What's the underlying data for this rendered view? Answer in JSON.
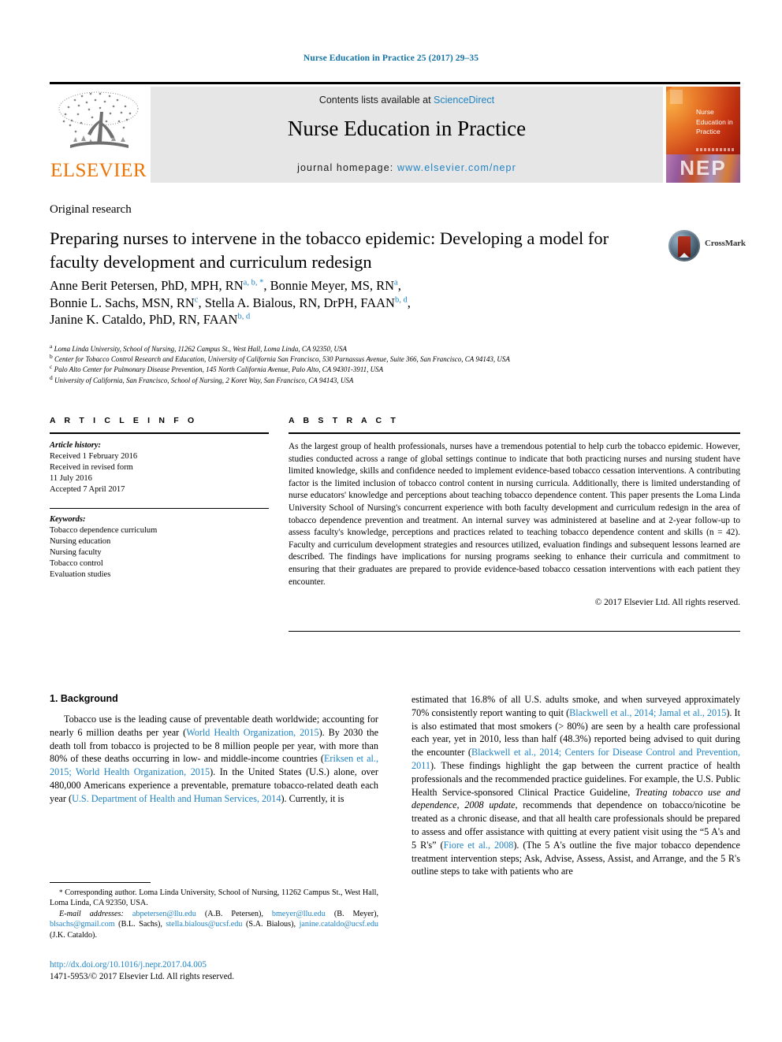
{
  "running_head": "Nurse Education in Practice 25 (2017) 29–35",
  "masthead": {
    "contents_prefix": "Contents lists available at ",
    "sciencedirect": "ScienceDirect",
    "journal_title": "Nurse Education in Practice",
    "homepage_prefix": "journal homepage: ",
    "homepage_url": "www.elsevier.com/nepr",
    "publisher_name": "ELSEVIER",
    "cover_title": "Nurse Education in Practice",
    "cover_abbrev": "NEP",
    "accent_link_color": "#1f83c4",
    "publisher_color": "#ec7404"
  },
  "article": {
    "type": "Original research",
    "title": "Preparing nurses to intervene in the tobacco epidemic: Developing a model for faculty development and curriculum redesign",
    "crossmark_label": "CrossMark"
  },
  "authors": {
    "line1": "Anne Berit Petersen, PhD, MPH, RN",
    "line1_marks": "a, b, *",
    "line1_cont": ", Bonnie Meyer, MS, RN",
    "line1_cont_marks": "a",
    "line2": "Bonnie L. Sachs, MSN, RN",
    "line2_marks": "c",
    "line2_cont": ", Stella A. Bialous, RN, DrPH, FAAN",
    "line2_cont_marks": "b, d",
    "line3": "Janine K. Cataldo, PhD, RN, FAAN",
    "line3_marks": "b, d"
  },
  "affiliations": [
    {
      "mark": "a",
      "text": "Loma Linda University, School of Nursing, 11262 Campus St., West Hall, Loma Linda, CA 92350, USA"
    },
    {
      "mark": "b",
      "text": "Center for Tobacco Control Research and Education, University of California San Francisco, 530 Parnassus Avenue, Suite 366, San Francisco, CA 94143, USA"
    },
    {
      "mark": "c",
      "text": "Palo Alto Center for Pulmonary Disease Prevention, 145 North California Avenue, Palo Alto, CA 94301-3911, USA"
    },
    {
      "mark": "d",
      "text": "University of California, San Francisco, School of Nursing, 2 Koret Way, San Francisco, CA 94143, USA"
    }
  ],
  "article_info": {
    "heading": "A R T I C L E  I N F O",
    "history_label": "Article history:",
    "history": [
      "Received 1 February 2016",
      "Received in revised form",
      "11 July 2016",
      "Accepted 7 April 2017"
    ],
    "keywords_label": "Keywords:",
    "keywords": [
      "Tobacco dependence curriculum",
      "Nursing education",
      "Nursing faculty",
      "Tobacco control",
      "Evaluation studies"
    ]
  },
  "abstract": {
    "heading": "A B S T R A C T",
    "text": "As the largest group of health professionals, nurses have a tremendous potential to help curb the tobacco epidemic. However, studies conducted across a range of global settings continue to indicate that both practicing nurses and nursing student have limited knowledge, skills and confidence needed to implement evidence-based tobacco cessation interventions. A contributing factor is the limited inclusion of tobacco control content in nursing curricula. Additionally, there is limited understanding of nurse educators' knowledge and perceptions about teaching tobacco dependence content. This paper presents the Loma Linda University School of Nursing's concurrent experience with both faculty development and curriculum redesign in the area of tobacco dependence prevention and treatment. An internal survey was administered at baseline and at 2-year follow-up to assess faculty's knowledge, perceptions and practices related to teaching tobacco dependence content and skills (n = 42). Faculty and curriculum development strategies and resources utilized, evaluation findings and subsequent lessons learned are described. The findings have implications for nursing programs seeking to enhance their curricula and commitment to ensuring that their graduates are prepared to provide evidence-based tobacco cessation interventions with each patient they encounter.",
    "copyright": "© 2017 Elsevier Ltd. All rights reserved."
  },
  "body": {
    "section_heading": "1. Background",
    "left_para_1": "Tobacco use is the leading cause of preventable death worldwide; accounting for nearly 6 million deaths per year (",
    "left_ref_1": "World Health Organization, 2015",
    "left_para_2": "). By 2030 the death toll from tobacco is projected to be 8 million people per year, with more than 80% of these deaths occurring in low- and middle-income countries (",
    "left_ref_2": "Eriksen et al., 2015; World Health Organization, 2015",
    "left_para_3": "). In the United States (U.S.) alone, over 480,000 Americans experience a preventable, premature tobacco-related death each year (",
    "left_ref_3": "U.S. Department of Health and Human Services, 2014",
    "left_para_4": "). Currently, it is",
    "right_para_1": "estimated that 16.8% of all U.S. adults smoke, and when surveyed approximately 70% consistently report wanting to quit (",
    "right_ref_1": "Blackwell et al., 2014; Jamal et al., 2015",
    "right_para_2": "). It is also estimated that most smokers (> 80%) are seen by a health care professional each year, yet in 2010, less than half (48.3%) reported being advised to quit during the encounter (",
    "right_ref_2": "Blackwell et al., 2014; Centers for Disease Control and Prevention, 2011",
    "right_para_3": "). These findings highlight the gap between the current practice of health professionals and the recommended practice guidelines. For example, the U.S. Public Health Service-sponsored Clinical Practice Guideline, ",
    "right_italic_1": "Treating tobacco use and dependence, 2008 update",
    "right_para_4": ", recommends that dependence on tobacco/nicotine be treated as a chronic disease, and that all health care professionals should be prepared to assess and offer assistance with quitting at every patient visit using the “5 A's and 5 R's” (",
    "right_ref_3": "Fiore et al., 2008",
    "right_para_5": "). (The 5 A's outline the five major tobacco dependence treatment intervention steps; Ask, Advise, Assess, Assist, and Arrange, and the 5 R's outline steps to take with patients who are"
  },
  "footnotes": {
    "corresponding": "Corresponding author. Loma Linda University, School of Nursing, 11262 Campus St., West Hall, Loma Linda, CA 92350, USA.",
    "email_label": "E-mail addresses:",
    "emails": [
      {
        "address": "abpetersen@llu.edu",
        "owner": "(A.B. Petersen)"
      },
      {
        "address": "bmeyer@llu.edu",
        "owner": "(B. Meyer)"
      },
      {
        "address": "blsachs@gmail.com",
        "owner": "(B.L. Sachs)"
      },
      {
        "address": "stella.bialous@ucsf.edu",
        "owner": "(S.A. Bialous)"
      },
      {
        "address": "janine.cataldo@ucsf.edu",
        "owner": "(J.K. Cataldo)"
      }
    ]
  },
  "doi": {
    "url": "http://dx.doi.org/10.1016/j.nepr.2017.04.005",
    "issn_line": "1471-5953/© 2017 Elsevier Ltd. All rights reserved."
  }
}
